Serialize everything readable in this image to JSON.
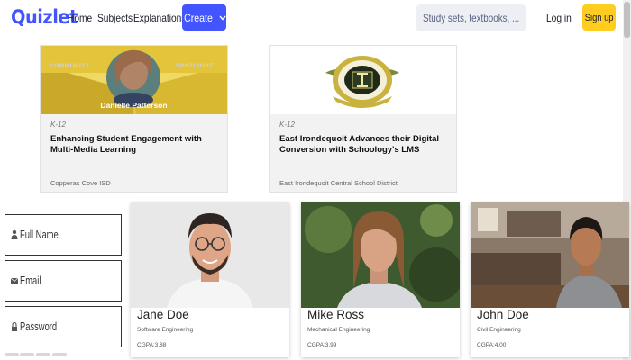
{
  "nav": {
    "logo": "Quizlet",
    "links": [
      "Home",
      "Subjects",
      "Explanations"
    ],
    "create_label": "Create",
    "search_placeholder": "Study sets, textbooks, ...",
    "login_label": "Log in",
    "signup_label": "Sign up",
    "brand_color": "#4255ff",
    "signup_color": "#ffcd1f"
  },
  "stories": [
    {
      "banner_left": "COMMUNITY",
      "banner_right": "SPOTLIGHT",
      "person": "Danielle Patterson",
      "tag": "K-12",
      "title": "Enhancing Student Engagement with Multi-Media Learning",
      "org": "Copperas Cove ISD"
    },
    {
      "tag": "K-12",
      "title": "East Irondequoit Advances their Digital Conversion with Schoology's LMS",
      "org": "East Irondequoit Central School District"
    }
  ],
  "form": {
    "fields": [
      {
        "icon": "user-icon",
        "label": "Full Name"
      },
      {
        "icon": "envelope-icon",
        "label": "Email"
      },
      {
        "icon": "lock-icon",
        "label": "Password"
      }
    ]
  },
  "profiles": [
    {
      "name": "Jane Doe",
      "dept": "Software Engineering",
      "cgpa": "CGPA:3.88"
    },
    {
      "name": "Mike Ross",
      "dept": "Mechanical Engineering",
      "cgpa": "CGPA:3.99"
    },
    {
      "name": "John Doe",
      "dept": "Civil Engineering",
      "cgpa": "CGPA:4.00"
    }
  ]
}
